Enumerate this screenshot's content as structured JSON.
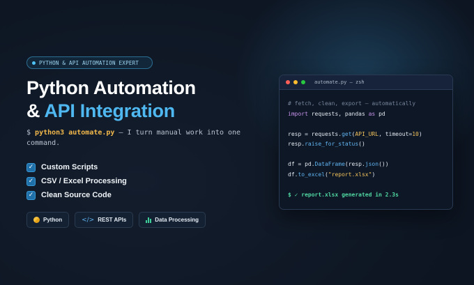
{
  "badge": {
    "text": "PYTHON & API AUTOMATION EXPERT"
  },
  "headline": {
    "line1": "Python Automation",
    "line2_prefix": "& ",
    "line2_accent": "API Integration"
  },
  "description": {
    "prompt": "$ ",
    "command": "python3 automate.py",
    "text": " — I turn manual work into one command."
  },
  "features": [
    {
      "check": "✓",
      "label": "Custom Scripts"
    },
    {
      "check": "✓",
      "label": "CSV / Excel Processing"
    },
    {
      "check": "✓",
      "label": "Clean Source Code"
    }
  ],
  "chips": [
    {
      "label": "Python",
      "icon": "python-logo-icon"
    },
    {
      "label": "REST APIs",
      "icon": "code-brackets-icon"
    },
    {
      "label": "Data Processing",
      "icon": "bar-chart-icon"
    }
  ],
  "terminal": {
    "title": "automate.py — zsh",
    "dots": [
      "#ff5f57",
      "#febc2e",
      "#28c840"
    ],
    "comment": "# fetch, clean, export — automatically",
    "l2_kw": "import",
    "l2_mid": " requests, pandas ",
    "l2_as": "as",
    "l2_end": " pd",
    "l4_var": "resp",
    "l4_eq": " = requests.",
    "l4_fn": "get",
    "l4_open": "(",
    "l4_arg": "API_URL",
    "l4_mid": ", timeout=",
    "l4_num": "10",
    "l4_close": ")",
    "l5_obj": "resp.",
    "l5_fn": "raise_for_status",
    "l5_end": "()",
    "l7_start": "df = pd.",
    "l7_fn": "DataFrame",
    "l7_mid": "(resp.",
    "l7_fn2": "json",
    "l7_end": "())",
    "l8_start": "df.",
    "l8_fn": "to_excel",
    "l8_open": "(",
    "l8_str": "\"report.xlsx\"",
    "l8_close": ")",
    "output": "$ ✓ report.xlsx generated in 2.3s"
  },
  "colors": {
    "accent": "#4fb8f0",
    "command": "#f2b84b",
    "success": "#4fd6a0"
  }
}
